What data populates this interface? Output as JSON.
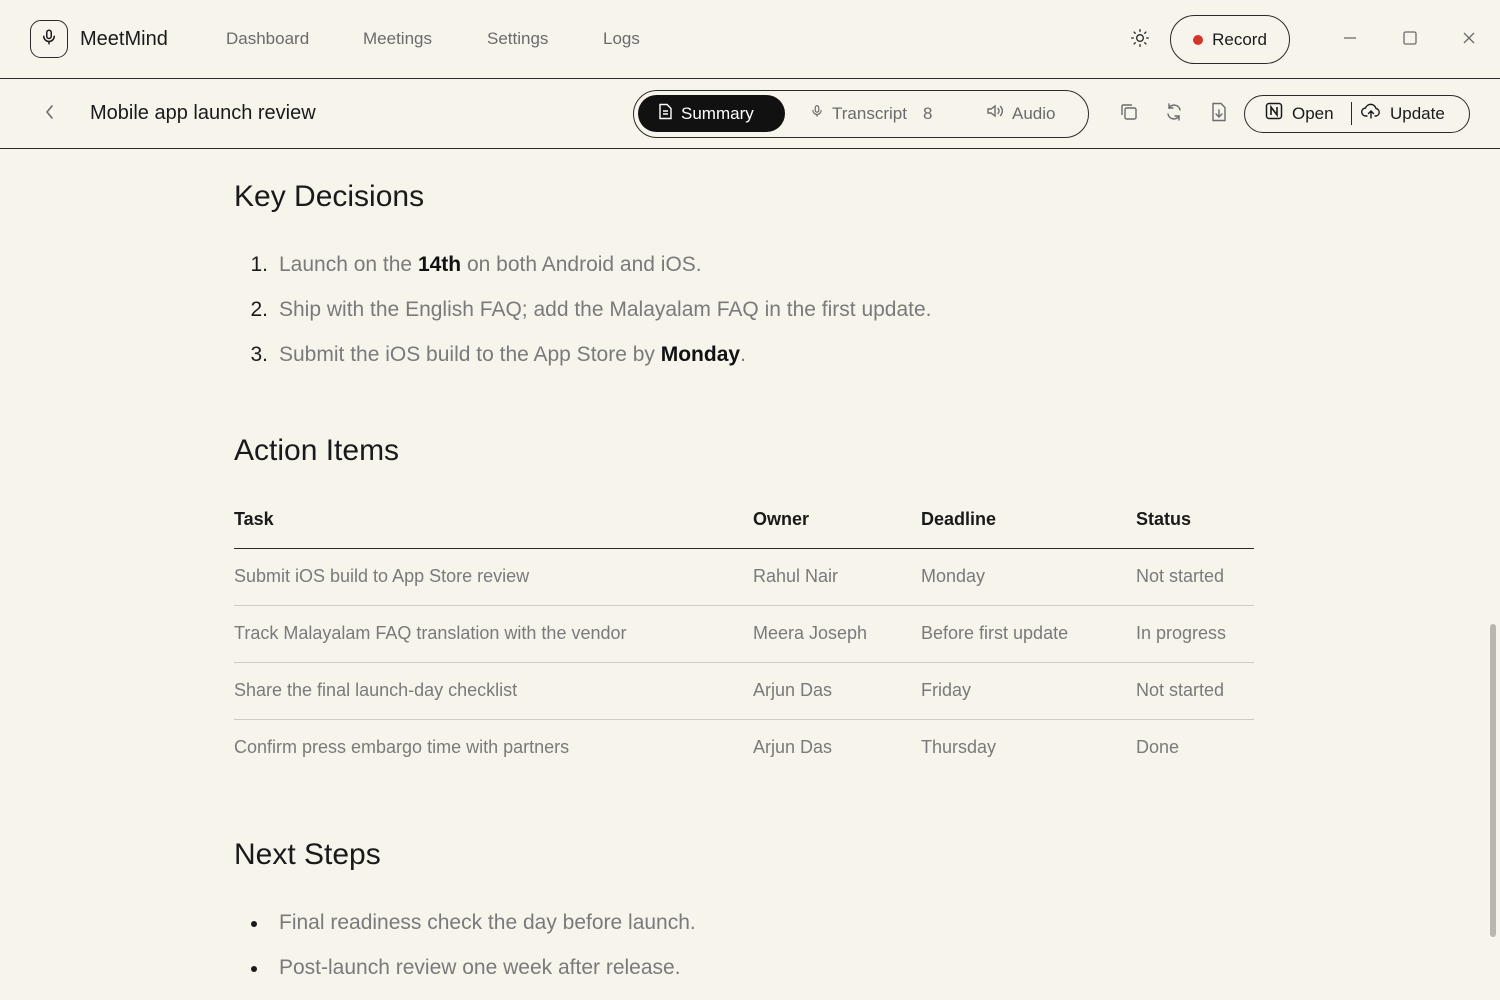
{
  "app": {
    "name": "MeetMind"
  },
  "nav": {
    "items": [
      "Dashboard",
      "Meetings",
      "Settings",
      "Logs"
    ]
  },
  "header": {
    "record_label": "Record"
  },
  "meeting": {
    "title": "Mobile app launch review"
  },
  "tabs": {
    "summary": "Summary",
    "transcript": "Transcript",
    "transcript_count": "8",
    "audio": "Audio"
  },
  "actions": {
    "open_label": "Open",
    "update_label": "Update"
  },
  "sections": {
    "decisions_title": "Key Decisions",
    "action_items_title": "Action Items",
    "next_steps_title": "Next Steps"
  },
  "decisions": [
    {
      "num": "1.",
      "pre": "Launch on the ",
      "bold": "14th",
      "post": " on both Android and iOS."
    },
    {
      "num": "2.",
      "pre": "Ship with the English FAQ; add the Malayalam FAQ in the first update.",
      "bold": "",
      "post": ""
    },
    {
      "num": "3.",
      "pre": "Submit the iOS build to the App Store by ",
      "bold": "Monday",
      "post": "."
    }
  ],
  "action_table": {
    "headers": [
      "Task",
      "Owner",
      "Deadline",
      "Status"
    ],
    "rows": [
      [
        "Submit iOS build to App Store review",
        "Rahul Nair",
        "Monday",
        "Not started"
      ],
      [
        "Track Malayalam FAQ translation with the vendor",
        "Meera Joseph",
        "Before first update",
        "In progress"
      ],
      [
        "Share the final launch-day checklist",
        "Arjun Das",
        "Friday",
        "Not started"
      ],
      [
        "Confirm press embargo time with partners",
        "Arjun Das",
        "Thursday",
        "Done"
      ]
    ]
  },
  "next_steps": [
    "Final readiness check the day before launch.",
    "Post-launch review one week after release."
  ],
  "colors": {
    "record_dot": "#d6342a",
    "active_tab_bg": "#111111",
    "background": "#f7f4ec"
  },
  "icons": [
    "microphone-icon",
    "sun-icon",
    "minimize-icon",
    "maximize-icon",
    "close-icon",
    "chevron-left-icon",
    "document-icon",
    "speaker-icon",
    "copy-icon",
    "refresh-icon",
    "download-icon",
    "notion-icon",
    "cloud-upload-icon"
  ]
}
